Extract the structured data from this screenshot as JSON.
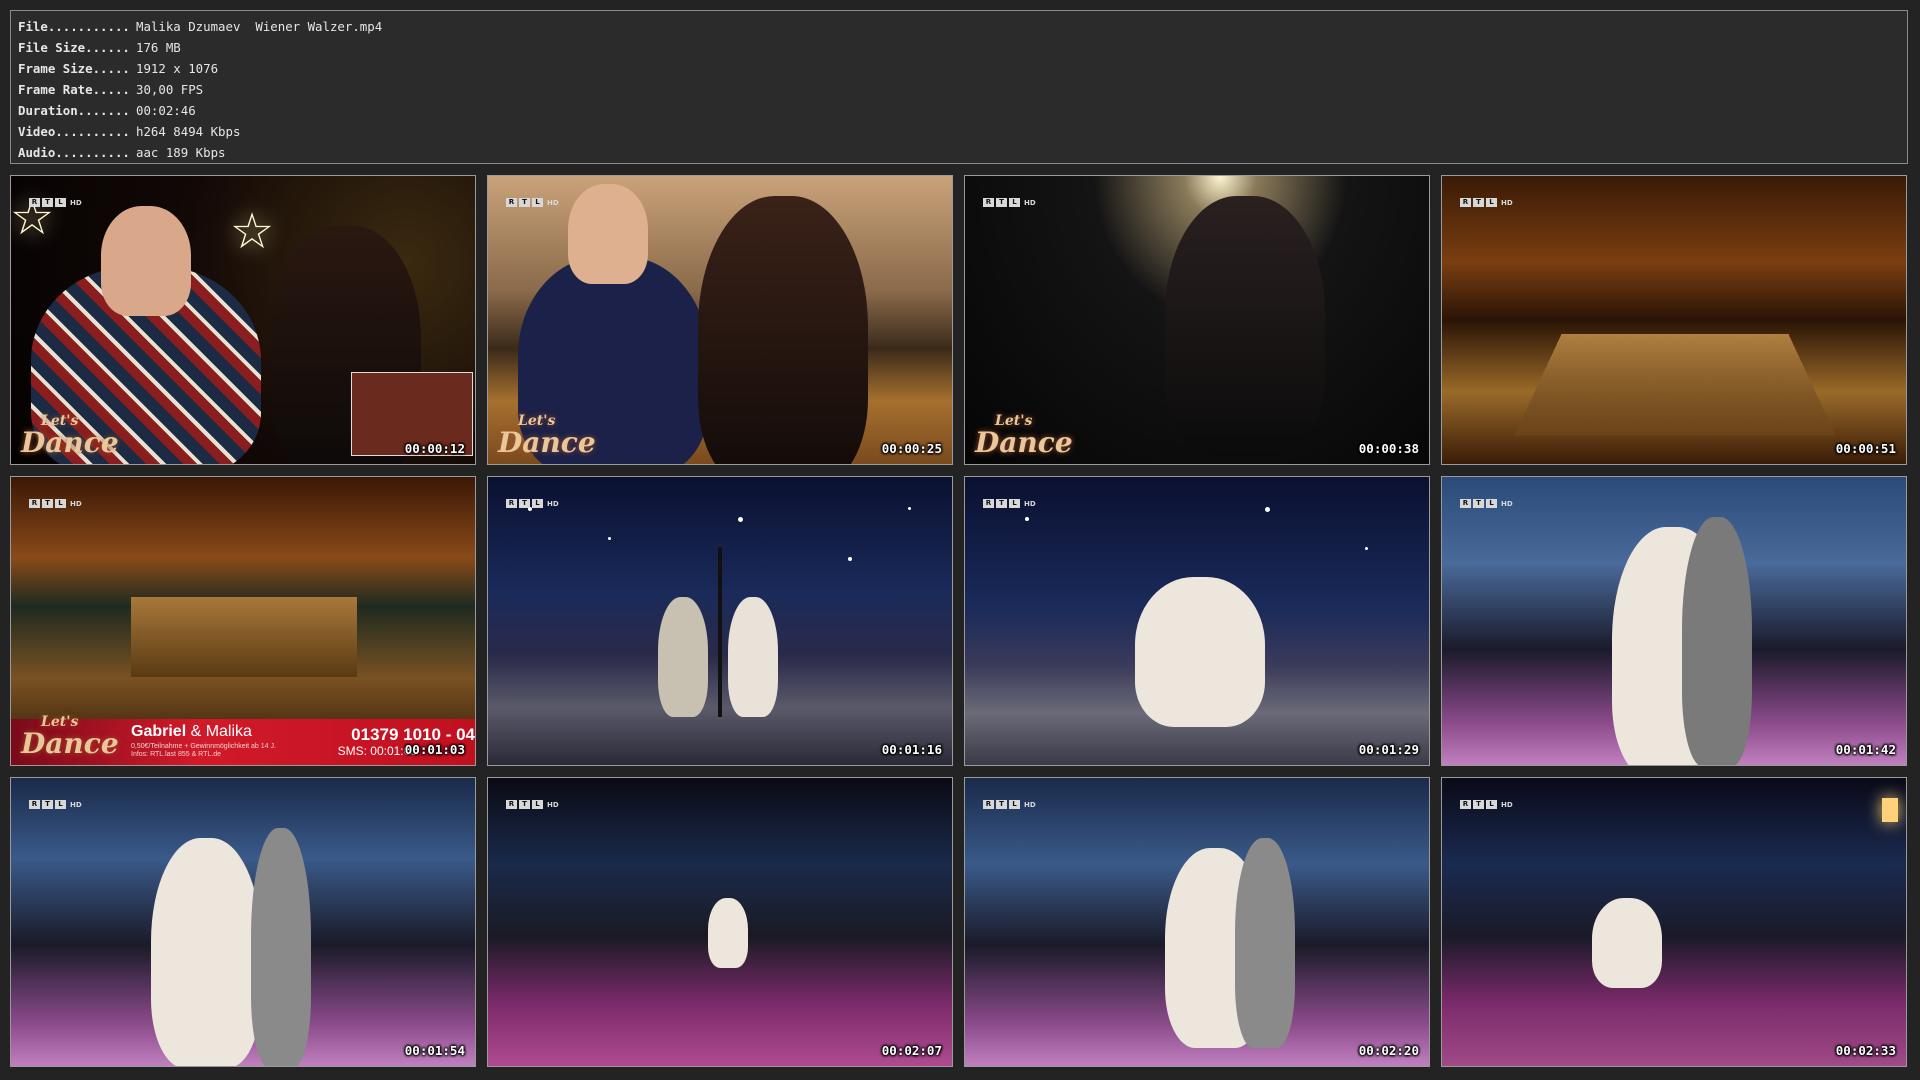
{
  "info": {
    "rows": [
      {
        "key": "File...........",
        "value": "Malika Dzumaev  Wiener Walzer.mp4"
      },
      {
        "key": "File Size......",
        "value": "176 MB"
      },
      {
        "key": "Frame Size.....",
        "value": "1912 x 1076"
      },
      {
        "key": "Frame Rate.....",
        "value": "30,00 FPS"
      },
      {
        "key": "Duration.......",
        "value": "00:02:46"
      },
      {
        "key": "Video..........",
        "value": "h264 8494 Kbps"
      },
      {
        "key": "Audio..........",
        "value": "aac 189 Kbps"
      }
    ]
  },
  "channel_logo": {
    "letters": [
      "R",
      "T",
      "L"
    ],
    "suffix": "HD"
  },
  "show_logo": {
    "top": "Let's",
    "bottom": "Dance"
  },
  "lower_third": {
    "name1": "Gabriel",
    "amp": " & ",
    "name2": "Malika",
    "phone": "01379 1010 - 04",
    "small_line1": "0,50€/Teilnahme + Gewinnmöglichkeit ab 14 J.",
    "small_line2": "Infos: RTL.last 855 & RTL.de",
    "sms": "SMS: 00:01:03"
  },
  "thumbnails": [
    {
      "timestamp": "00:00:12",
      "scene": "christmas-interview"
    },
    {
      "timestamp": "00:00:25",
      "scene": "rehearsal-studio"
    },
    {
      "timestamp": "00:00:38",
      "scene": "dark-photoshoot"
    },
    {
      "timestamp": "00:00:51",
      "scene": "ballroom-overview"
    },
    {
      "timestamp": "00:01:03",
      "scene": "ballroom-lowerthird"
    },
    {
      "timestamp": "00:01:16",
      "scene": "night-lamppost"
    },
    {
      "timestamp": "00:01:29",
      "scene": "night-spin"
    },
    {
      "timestamp": "00:01:42",
      "scene": "winter-closeup"
    },
    {
      "timestamp": "00:01:54",
      "scene": "winter-closeup-2"
    },
    {
      "timestamp": "00:02:07",
      "scene": "stage-wide"
    },
    {
      "timestamp": "00:02:20",
      "scene": "winter-dip"
    },
    {
      "timestamp": "00:02:33",
      "scene": "stage-lamp"
    }
  ],
  "colors": {
    "background": "#232323",
    "border": "#9a9a9a",
    "text": "#e6e6e6"
  }
}
